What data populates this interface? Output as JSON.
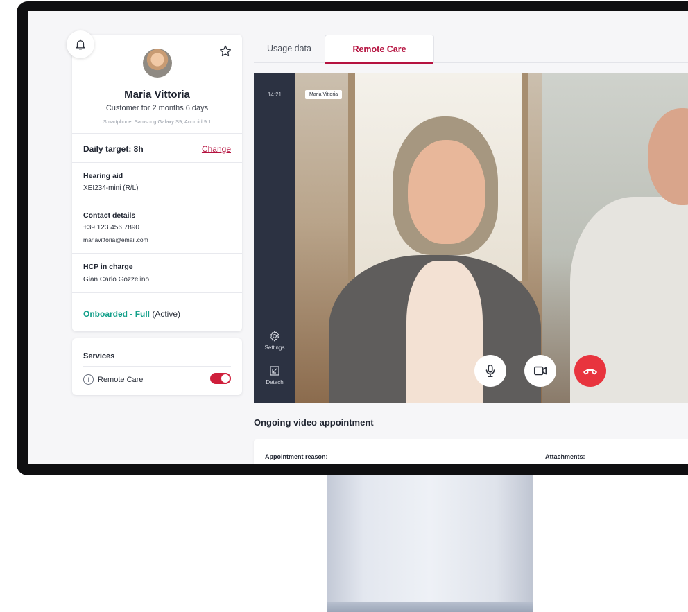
{
  "patient": {
    "name": "Maria Vittoria",
    "customer_since": "Customer for 2 months 6 days",
    "device": "Smartphone: Samsung Galaxy S9, Android 9.1",
    "daily_target_label": "Daily target: 8h",
    "change_link": "Change",
    "hearing_aid": {
      "label": "Hearing aid",
      "value": "XEI234-mini (R/L)"
    },
    "contact": {
      "label": "Contact details",
      "phone": "+39 123 456 7890",
      "email": "mariavittoria@email.com"
    },
    "hcp": {
      "label": "HCP in charge",
      "value": "Gian Carlo Gozzelino"
    },
    "status": {
      "onboarded": "Onboarded",
      "separator": " - ",
      "level": "Full",
      "state": " (Active)"
    }
  },
  "services": {
    "title": "Services",
    "items": [
      {
        "label": "Remote Care",
        "enabled": true
      }
    ]
  },
  "tabs": [
    {
      "label": "Usage data",
      "active": false
    },
    {
      "label": "Remote Care",
      "active": true
    }
  ],
  "video": {
    "time": "14:21",
    "participant_tag": "Maria Vittoria",
    "settings_label": "Settings",
    "detach_label": "Detach"
  },
  "appointment": {
    "title": "Ongoing video appointment",
    "reason_label": "Appointment reason:",
    "attachments_label": "Attachments:"
  },
  "colors": {
    "accent": "#b5123f",
    "toggle_on": "#cf1f3b",
    "end_call": "#e8343e",
    "status_green": "#13a08a"
  },
  "icons": [
    "bell-icon",
    "star-icon",
    "info-icon",
    "settings-icon",
    "detach-icon",
    "microphone-icon",
    "camera-icon",
    "phone-hangup-icon"
  ]
}
